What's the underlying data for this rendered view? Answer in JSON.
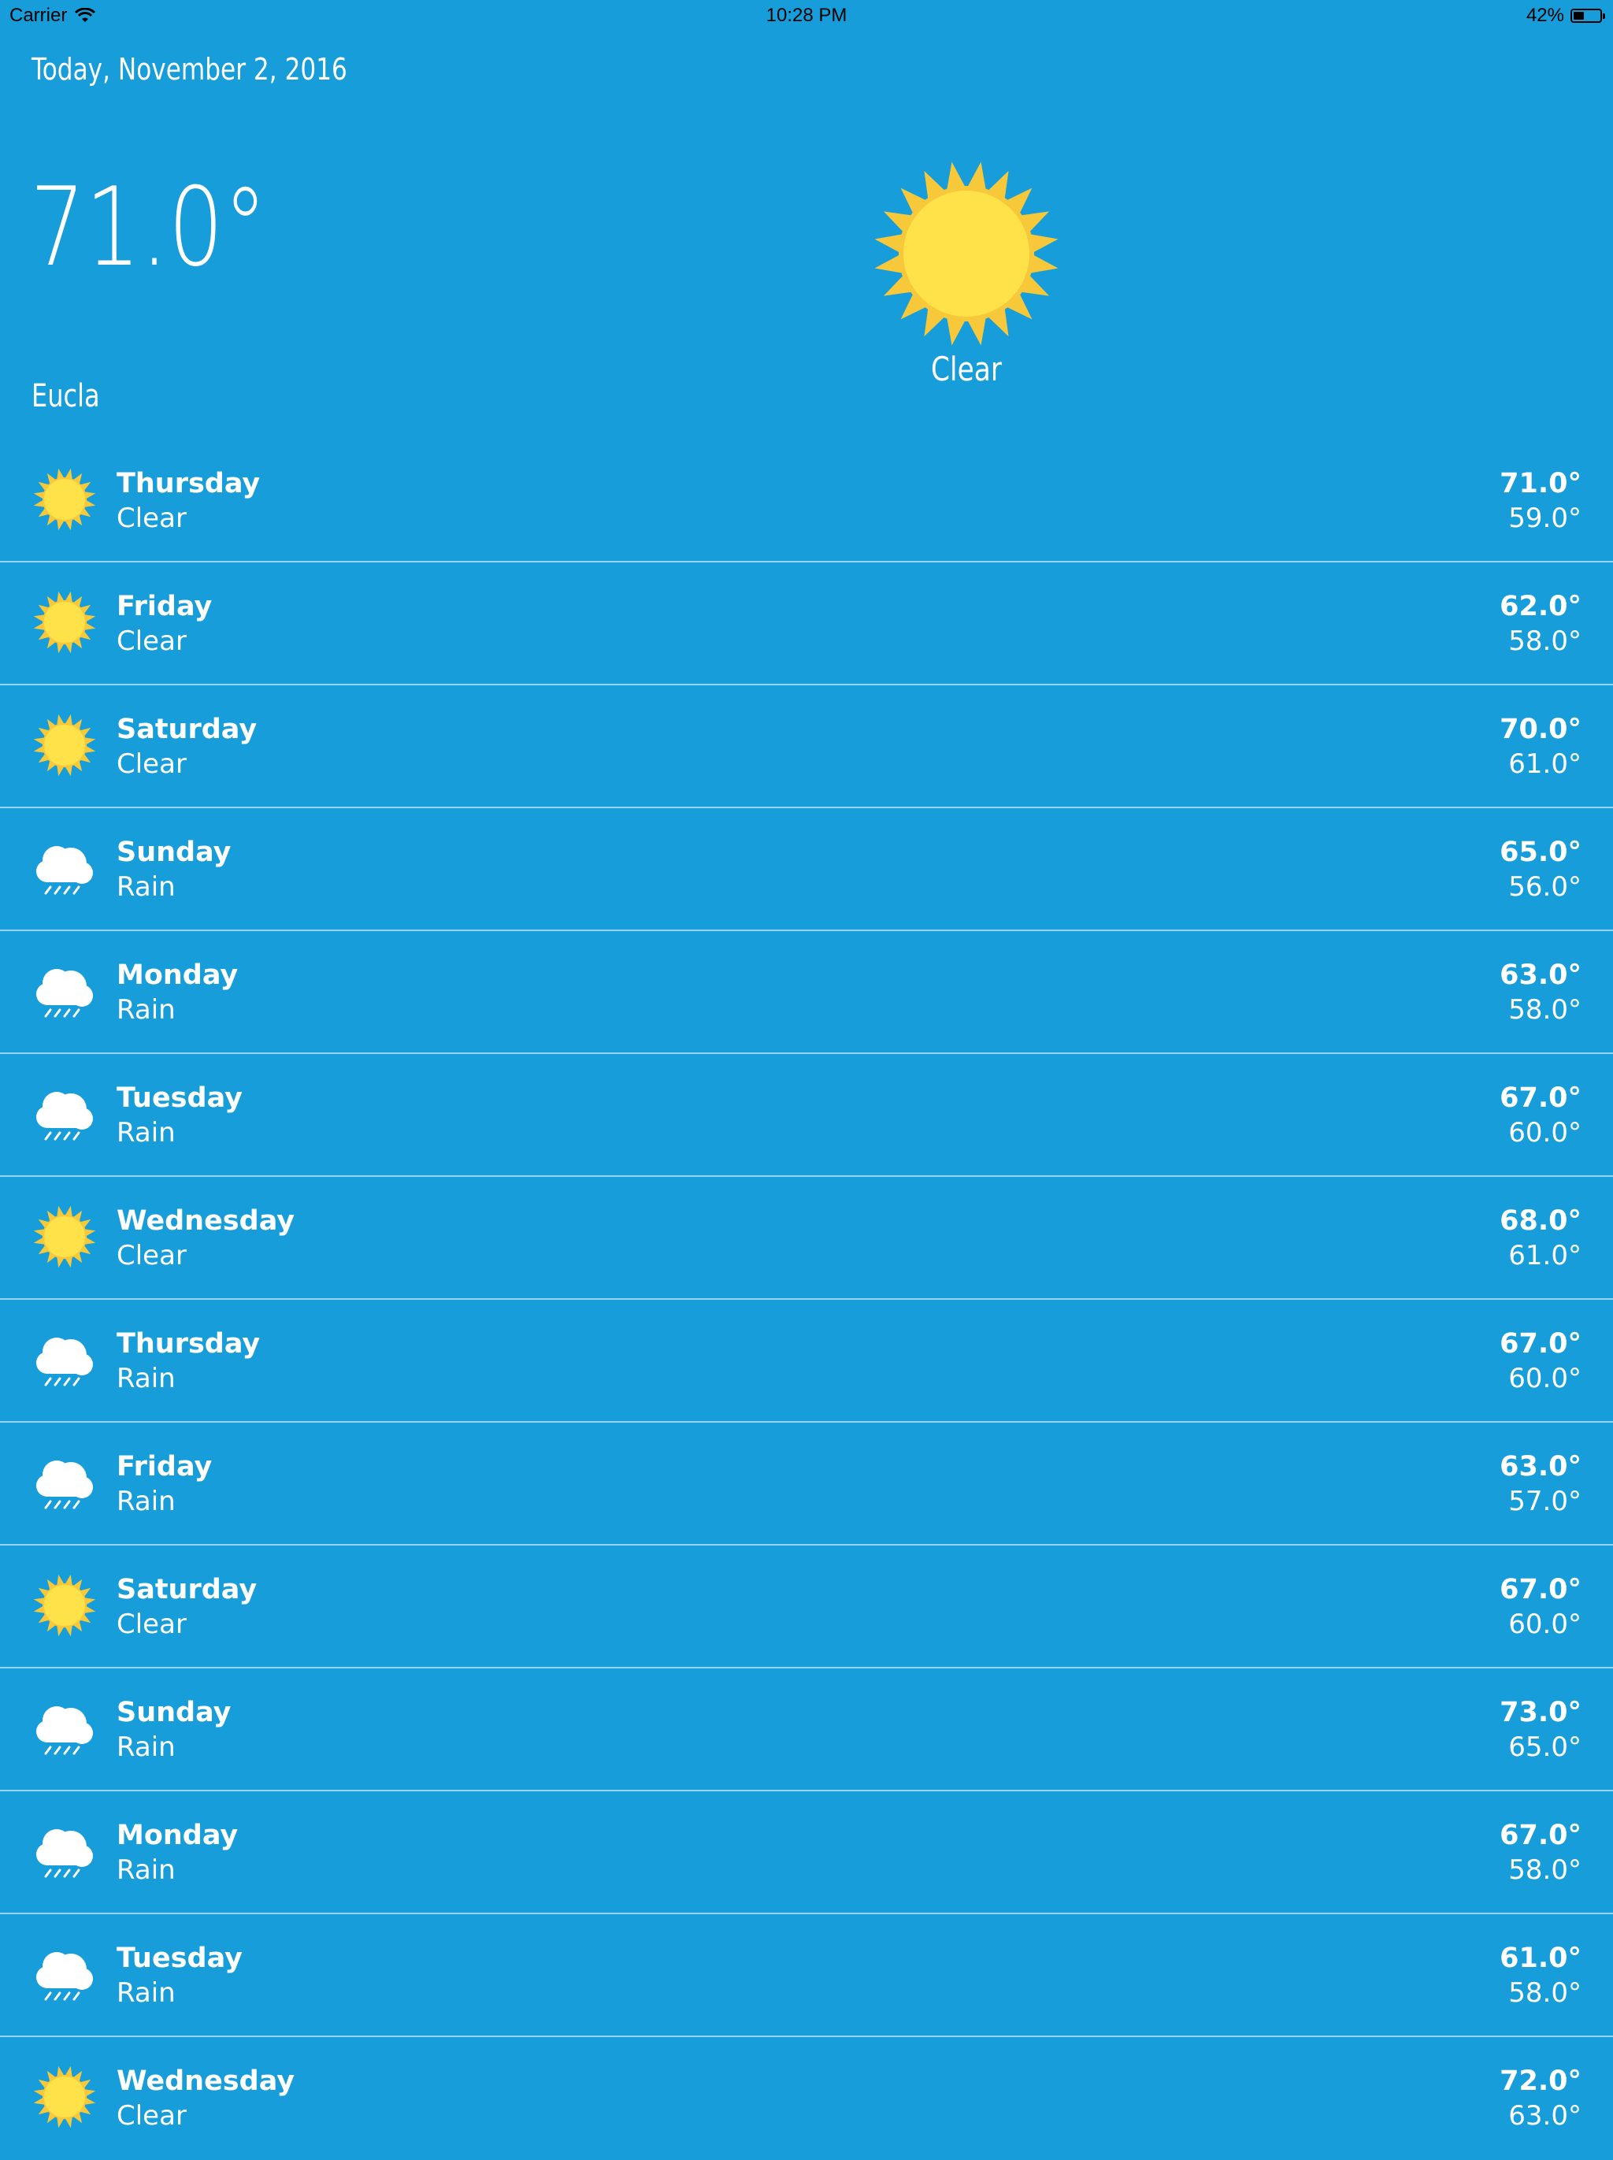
{
  "status_bar": {
    "carrier": "Carrier",
    "time": "10:28 PM",
    "battery_percent": "42%",
    "battery_level": 0.42
  },
  "header": {
    "date": "Today, November 2, 2016",
    "current_temp": "71.0°",
    "location": "Eucla",
    "condition": "Clear",
    "condition_icon": "sun-icon"
  },
  "colors": {
    "background": "#179dd9",
    "sun": "#ffe14a",
    "sun_rays": "#f6c83a",
    "text": "#ffffff"
  },
  "forecast": [
    {
      "day": "Thursday",
      "condition": "Clear",
      "icon": "sun-icon",
      "high": "71.0°",
      "low": "59.0°"
    },
    {
      "day": "Friday",
      "condition": "Clear",
      "icon": "sun-icon",
      "high": "62.0°",
      "low": "58.0°"
    },
    {
      "day": "Saturday",
      "condition": "Clear",
      "icon": "sun-icon",
      "high": "70.0°",
      "low": "61.0°"
    },
    {
      "day": "Sunday",
      "condition": "Rain",
      "icon": "rain-cloud-icon",
      "high": "65.0°",
      "low": "56.0°"
    },
    {
      "day": "Monday",
      "condition": "Rain",
      "icon": "rain-cloud-icon",
      "high": "63.0°",
      "low": "58.0°"
    },
    {
      "day": "Tuesday",
      "condition": "Rain",
      "icon": "rain-cloud-icon",
      "high": "67.0°",
      "low": "60.0°"
    },
    {
      "day": "Wednesday",
      "condition": "Clear",
      "icon": "sun-icon",
      "high": "68.0°",
      "low": "61.0°"
    },
    {
      "day": "Thursday",
      "condition": "Rain",
      "icon": "rain-cloud-icon",
      "high": "67.0°",
      "low": "60.0°"
    },
    {
      "day": "Friday",
      "condition": "Rain",
      "icon": "rain-cloud-icon",
      "high": "63.0°",
      "low": "57.0°"
    },
    {
      "day": "Saturday",
      "condition": "Clear",
      "icon": "sun-icon",
      "high": "67.0°",
      "low": "60.0°"
    },
    {
      "day": "Sunday",
      "condition": "Rain",
      "icon": "rain-cloud-icon",
      "high": "73.0°",
      "low": "65.0°"
    },
    {
      "day": "Monday",
      "condition": "Rain",
      "icon": "rain-cloud-icon",
      "high": "67.0°",
      "low": "58.0°"
    },
    {
      "day": "Tuesday",
      "condition": "Rain",
      "icon": "rain-cloud-icon",
      "high": "61.0°",
      "low": "58.0°"
    },
    {
      "day": "Wednesday",
      "condition": "Clear",
      "icon": "sun-icon",
      "high": "72.0°",
      "low": "63.0°"
    }
  ]
}
